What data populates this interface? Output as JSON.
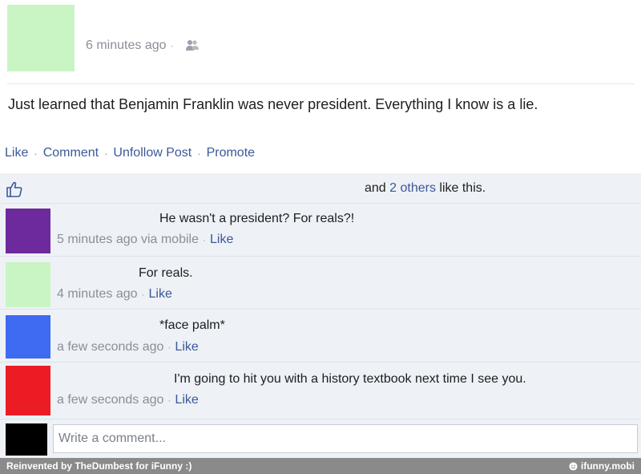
{
  "colors": {
    "post_avatar": "#c8f5c3",
    "c1_avatar": "#6d2a9c",
    "c2_avatar": "#c8f5c3",
    "c3_avatar": "#3f6af2",
    "c4_avatar": "#ec1c24",
    "write_avatar": "#000000",
    "link": "#3b5998"
  },
  "post": {
    "timestamp": "6 minutes ago",
    "separator": "·",
    "audience_icon": "friends-icon",
    "text": "Just learned that Benjamin Franklin was never president. Everything I know is a lie."
  },
  "actions": {
    "like": "Like",
    "comment": "Comment",
    "unfollow": "Unfollow Post",
    "promote": "Promote",
    "separator": "·"
  },
  "likes": {
    "icon": "thumbs-up-icon",
    "prefix": "and ",
    "others": "2 others",
    "suffix": " like this."
  },
  "comments": [
    {
      "text": "He wasn't a president? For reals?!",
      "meta": "5 minutes ago via mobile",
      "like": "Like"
    },
    {
      "text": "For reals.",
      "meta": "4 minutes ago",
      "like": "Like"
    },
    {
      "text": "*face palm*",
      "meta": "a few seconds ago",
      "like": "Like"
    },
    {
      "text": "I'm going to hit you with a history textbook next time I see you.",
      "meta": "a few seconds ago",
      "like": "Like"
    }
  ],
  "composer": {
    "placeholder": "Write a comment..."
  },
  "footer": {
    "left": "Reinvented by TheDumbest for iFunny :)",
    "right": "ifunny.mobi",
    "icon": "smiley-icon"
  }
}
